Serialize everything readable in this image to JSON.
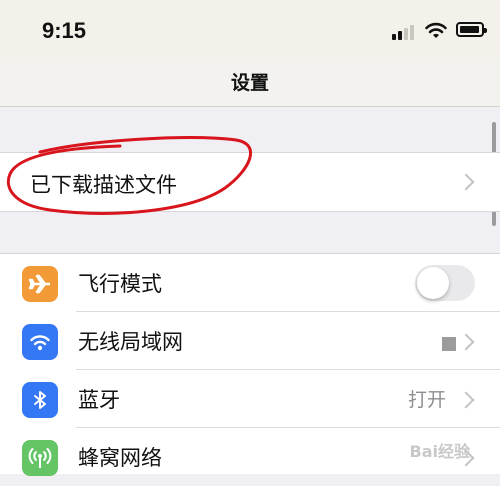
{
  "status_bar": {
    "time": "9:15"
  },
  "nav": {
    "title": "设置"
  },
  "profile_section": {
    "label": "已下载描述文件"
  },
  "settings": [
    {
      "label": "飞行模式",
      "icon": "airplane-icon",
      "icon_color": "#f19a37",
      "control": "toggle",
      "toggle_on": false
    },
    {
      "label": "无线局域网",
      "icon": "wifi-icon",
      "icon_color": "#3478f6",
      "control": "chevron",
      "value": ""
    },
    {
      "label": "蓝牙",
      "icon": "bluetooth-icon",
      "icon_color": "#3478f6",
      "control": "chevron",
      "value": "打开"
    },
    {
      "label": "蜂窝网络",
      "icon": "cellular-icon",
      "icon_color": "#65c466",
      "control": "chevron",
      "value": ""
    }
  ],
  "colors": {
    "annotation_red": "#d8141c",
    "background": "#efeff4"
  },
  "watermark": "Bai经验"
}
